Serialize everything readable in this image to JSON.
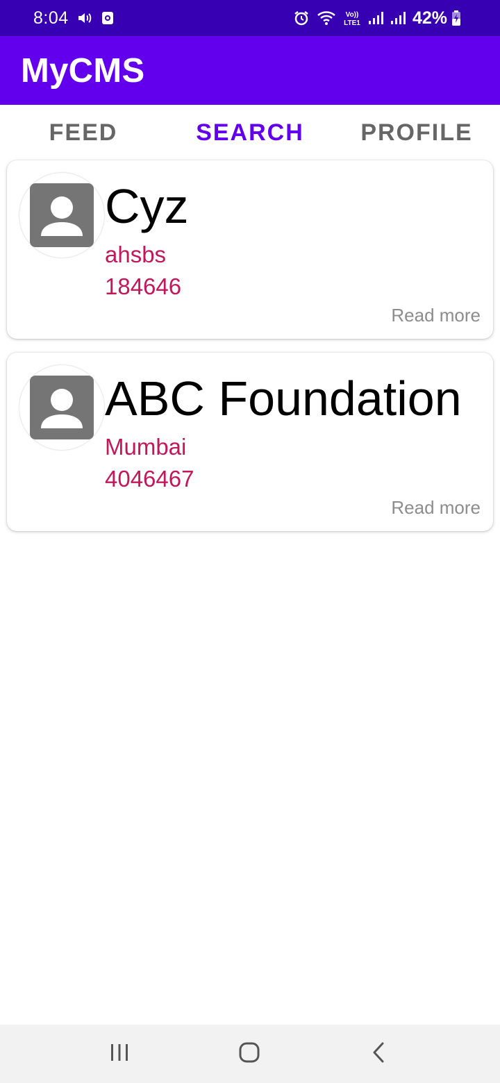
{
  "status_bar": {
    "time": "8:04",
    "battery": "42%",
    "icons": [
      "volume-icon",
      "screen-record-icon",
      "alarm-icon",
      "wifi-icon",
      "volte-lte-icon",
      "signal-icon",
      "signal-icon",
      "battery-charging-icon"
    ],
    "volte_label": "Vo))",
    "lte_label": "LTE1"
  },
  "app_bar": {
    "title": "MyCMS",
    "color": "#6200EE"
  },
  "tabs": [
    {
      "label": "FEED",
      "active": false
    },
    {
      "label": "SEARCH",
      "active": true
    },
    {
      "label": "PROFILE",
      "active": false
    }
  ],
  "results": [
    {
      "name": "Cyz",
      "location": "ahsbs",
      "number": "184646",
      "action": "Read more",
      "avatar_icon": "person-placeholder-icon"
    },
    {
      "name": "ABC Foundation",
      "location": "Mumbai",
      "number": "4046467",
      "action": "Read more",
      "avatar_icon": "person-placeholder-icon"
    }
  ],
  "nav_bar": {
    "icons": [
      "recents-icon",
      "home-icon",
      "back-icon"
    ]
  },
  "colors": {
    "status_bar": "#3700B3",
    "accent": "#6200EE",
    "secondary_text": "#C2185B",
    "tab_inactive": "#666666"
  }
}
